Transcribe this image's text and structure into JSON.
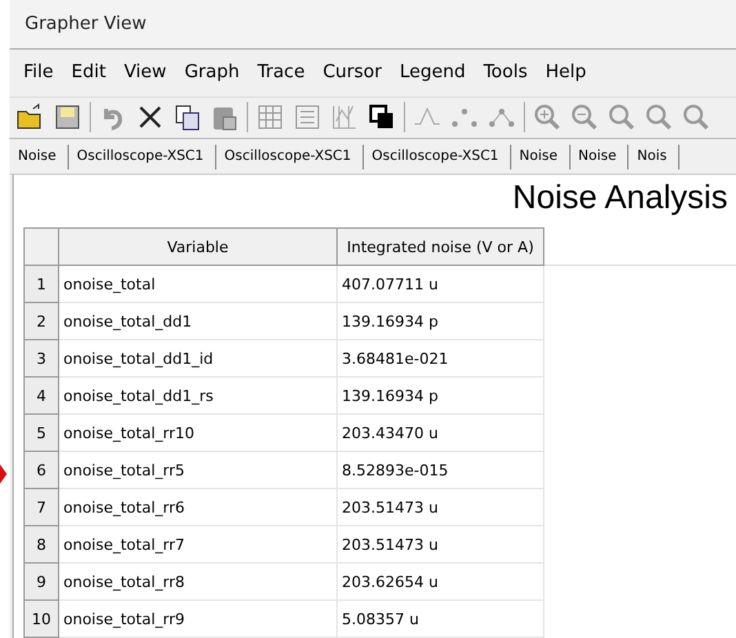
{
  "window": {
    "title": "Grapher View"
  },
  "menu": [
    "File",
    "Edit",
    "View",
    "Graph",
    "Trace",
    "Cursor",
    "Legend",
    "Tools",
    "Help"
  ],
  "toolbar": [
    {
      "kind": "open"
    },
    {
      "kind": "save"
    },
    {
      "kind": "sep"
    },
    {
      "kind": "undo"
    },
    {
      "kind": "cut"
    },
    {
      "kind": "copy"
    },
    {
      "kind": "paste"
    },
    {
      "kind": "sep"
    },
    {
      "kind": "grid"
    },
    {
      "kind": "legend"
    },
    {
      "kind": "cursors"
    },
    {
      "kind": "reverse"
    },
    {
      "kind": "sep"
    },
    {
      "kind": "lines"
    },
    {
      "kind": "points"
    },
    {
      "kind": "linespoints"
    },
    {
      "kind": "sep"
    },
    {
      "kind": "zoomin"
    },
    {
      "kind": "zoomout"
    },
    {
      "kind": "zoomfull"
    },
    {
      "kind": "zoomsel"
    },
    {
      "kind": "more"
    }
  ],
  "tabs": [
    "Noise",
    "Oscilloscope-XSC1",
    "Oscilloscope-XSC1",
    "Oscilloscope-XSC1",
    "Noise",
    "Noise",
    "Nois"
  ],
  "heading": "Noise Analysis",
  "table": {
    "columns": [
      "Variable",
      "Integrated noise (V or A)"
    ],
    "rows": [
      {
        "index": "1",
        "variable": "onoise_total",
        "value": "407.07711 u"
      },
      {
        "index": "2",
        "variable": "onoise_total_dd1",
        "value": "139.16934 p"
      },
      {
        "index": "3",
        "variable": "onoise_total_dd1_id",
        "value": "3.68481e-021"
      },
      {
        "index": "4",
        "variable": "onoise_total_dd1_rs",
        "value": "139.16934 p"
      },
      {
        "index": "5",
        "variable": "onoise_total_rr10",
        "value": "203.43470 u"
      },
      {
        "index": "6",
        "variable": "onoise_total_rr5",
        "value": "8.52893e-015"
      },
      {
        "index": "7",
        "variable": "onoise_total_rr6",
        "value": "203.51473 u"
      },
      {
        "index": "8",
        "variable": "onoise_total_rr7",
        "value": "203.51473 u"
      },
      {
        "index": "9",
        "variable": "onoise_total_rr8",
        "value": "203.62654 u"
      },
      {
        "index": "10",
        "variable": "onoise_total_rr9",
        "value": "5.08357 u"
      }
    ]
  }
}
